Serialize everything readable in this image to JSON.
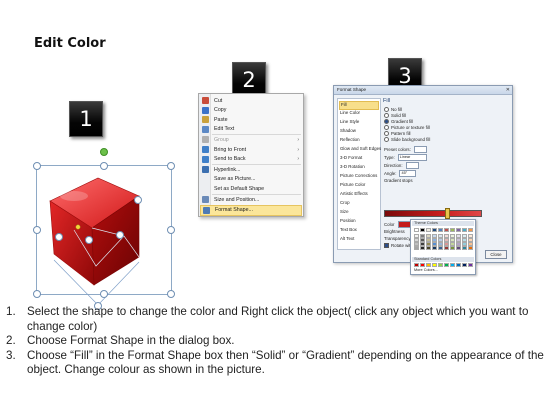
{
  "title": "Edit Color",
  "badges": [
    "1",
    "2",
    "3"
  ],
  "context_menu": {
    "items": [
      {
        "label": "Cut",
        "icon": "scissors-icon",
        "color": "#c94d3b"
      },
      {
        "label": "Copy",
        "icon": "copy-icon",
        "color": "#3b73c9"
      },
      {
        "label": "Paste",
        "icon": "clipboard-icon",
        "color": "#c9a13b"
      },
      {
        "label": "Edit Text",
        "icon": "edit-text-icon",
        "color": "#5b88c5"
      },
      {
        "label": "Group",
        "icon": "group-icon",
        "color": "#b0b0b0",
        "dim": true,
        "submenu": true
      },
      {
        "label": "Bring to Front",
        "icon": "bring-front-icon",
        "color": "#3f7fc8",
        "submenu": true
      },
      {
        "label": "Send to Back",
        "icon": "send-back-icon",
        "color": "#3f7fc8",
        "submenu": true
      },
      {
        "label": "Hyperlink...",
        "icon": "hyperlink-icon",
        "color": "#3b6fb0"
      },
      {
        "label": "Save as Picture...",
        "icon": "",
        "color": ""
      },
      {
        "label": "Set as Default Shape",
        "icon": "",
        "color": ""
      },
      {
        "label": "Size and Position...",
        "icon": "size-position-icon",
        "color": "#6a8ab8"
      },
      {
        "label": "Format Shape...",
        "icon": "format-shape-icon",
        "color": "#4f7bb5",
        "highlighted": true
      }
    ]
  },
  "dialog": {
    "title": "Format Shape",
    "categories": [
      "Fill",
      "Line Color",
      "Line Style",
      "Shadow",
      "Reflection",
      "Glow and Soft Edges",
      "3-D Format",
      "3-D Rotation",
      "Picture Corrections",
      "Picture Color",
      "Artistic Effects",
      "Crop",
      "Size",
      "Position",
      "Text Box",
      "Alt Text"
    ],
    "selected_category": "Fill",
    "fill_heading": "Fill",
    "fill_options": [
      {
        "label": "No fill",
        "on": false
      },
      {
        "label": "Solid fill",
        "on": false
      },
      {
        "label": "Gradient fill",
        "on": true
      },
      {
        "label": "Picture or texture fill",
        "on": false
      },
      {
        "label": "Pattern fill",
        "on": false
      },
      {
        "label": "Slide background fill",
        "on": false
      }
    ],
    "fields": [
      {
        "label": "Preset colors:"
      },
      {
        "label": "Type:",
        "value": "Linear"
      },
      {
        "label": "Direction:"
      },
      {
        "label": "Angle:",
        "value": "45°"
      },
      {
        "label": "Gradient stops"
      }
    ],
    "color_label": "Color",
    "position_label": "Position:",
    "position_value": "66%",
    "brightness_label": "Brightness",
    "transparency_label": "Transparency",
    "rotate_label": "Rotate with shape",
    "close_button": "Close",
    "palette": {
      "theme_label": "Theme Colors",
      "standard_label": "Standard Colors",
      "more_label": "More Colors...",
      "theme_top": [
        "#ffffff",
        "#000000",
        "#eeece1",
        "#1f497d",
        "#4f81bd",
        "#c0504d",
        "#9bbb59",
        "#8064a2",
        "#4bacc6",
        "#f79646"
      ],
      "theme_rows": [
        [
          "#f2f2f2",
          "#7f7f7f",
          "#ddd9c3",
          "#c6d9f0",
          "#dbe5f1",
          "#f2dcdb",
          "#ebf1dd",
          "#e5e0ec",
          "#dbeef3",
          "#fdeada"
        ],
        [
          "#d8d8d8",
          "#595959",
          "#c4bd97",
          "#8db3e2",
          "#b8cce4",
          "#e5b9b7",
          "#d7e3bc",
          "#ccc1d9",
          "#b7dde8",
          "#fbd5b5"
        ],
        [
          "#bfbfbf",
          "#3f3f3f",
          "#938953",
          "#548dd4",
          "#95b3d7",
          "#d99694",
          "#c3d69b",
          "#b2a2c7",
          "#92cddc",
          "#fac08f"
        ],
        [
          "#a5a5a5",
          "#262626",
          "#494429",
          "#17365d",
          "#366092",
          "#953734",
          "#76923c",
          "#5f497a",
          "#31859b",
          "#e36c09"
        ]
      ],
      "standard": [
        "#c00000",
        "#ff0000",
        "#ffc000",
        "#ffff00",
        "#92d050",
        "#00b050",
        "#00b0f0",
        "#0070c0",
        "#002060",
        "#7030a0"
      ]
    }
  },
  "instructions": [
    {
      "n": "1.",
      "text": "Select the shape to change the color and Right click the object( click any object which you want to change color)"
    },
    {
      "n": "2.",
      "text": "Choose Format Shape in the dialog box."
    },
    {
      "n": "3.",
      "text": "Choose “Fill” in the Format Shape box then “Solid” or “Gradient” depending on the appearance of the object. Change colour as shown in the picture."
    }
  ]
}
